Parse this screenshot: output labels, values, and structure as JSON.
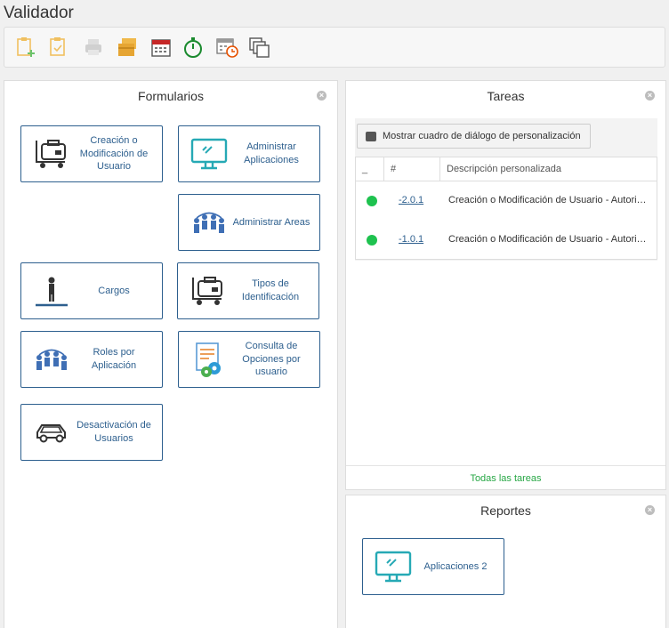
{
  "app": {
    "title": "Validador"
  },
  "toolbar": {
    "icons": [
      "new-form-icon",
      "checklist-icon",
      "print-icon",
      "folders-icon",
      "calendar-icon",
      "timer-icon",
      "calendar-clock-icon",
      "copy-windows-icon"
    ]
  },
  "formularios": {
    "title": "Formularios",
    "cards": [
      {
        "label": "Creación o Modificación de Usuario",
        "icon": "cart-card-icon"
      },
      {
        "label": "Administrar Aplicaciones",
        "icon": "monitor-icon"
      },
      {
        "label": "Administrar Areas",
        "icon": "people-network-icon"
      },
      {
        "label": "Cargos",
        "icon": "person-stand-icon"
      },
      {
        "label": "Tipos de Identificación",
        "icon": "cart-card-icon"
      },
      {
        "label": "Roles por Aplicación",
        "icon": "people-network-icon"
      },
      {
        "label": "Consulta de Opciones por usuario",
        "icon": "document-gears-icon"
      },
      {
        "label": "Desactivación de Usuarios",
        "icon": "car-icon"
      }
    ]
  },
  "tareas": {
    "title": "Tareas",
    "custom_button": "Mostrar cuadro de diálogo de personalización",
    "columns": [
      "_",
      "#",
      "Descripción personalizada"
    ],
    "rows": [
      {
        "number": "-2.0.1",
        "description": "Creación o Modificación de Usuario - Autorización",
        "status_color": "#1ec24f"
      },
      {
        "number": "-1.0.1",
        "description": "Creación o Modificación de Usuario - Autorización",
        "status_color": "#1ec24f"
      }
    ],
    "all_tasks": "Todas las tareas"
  },
  "reportes": {
    "title": "Reportes",
    "cards": [
      {
        "label": "Aplicaciones 2",
        "icon": "monitor-icon"
      }
    ]
  },
  "colors": {
    "accent": "#2d5f8e",
    "status_green": "#1ec24f",
    "link_green": "#27a745"
  }
}
